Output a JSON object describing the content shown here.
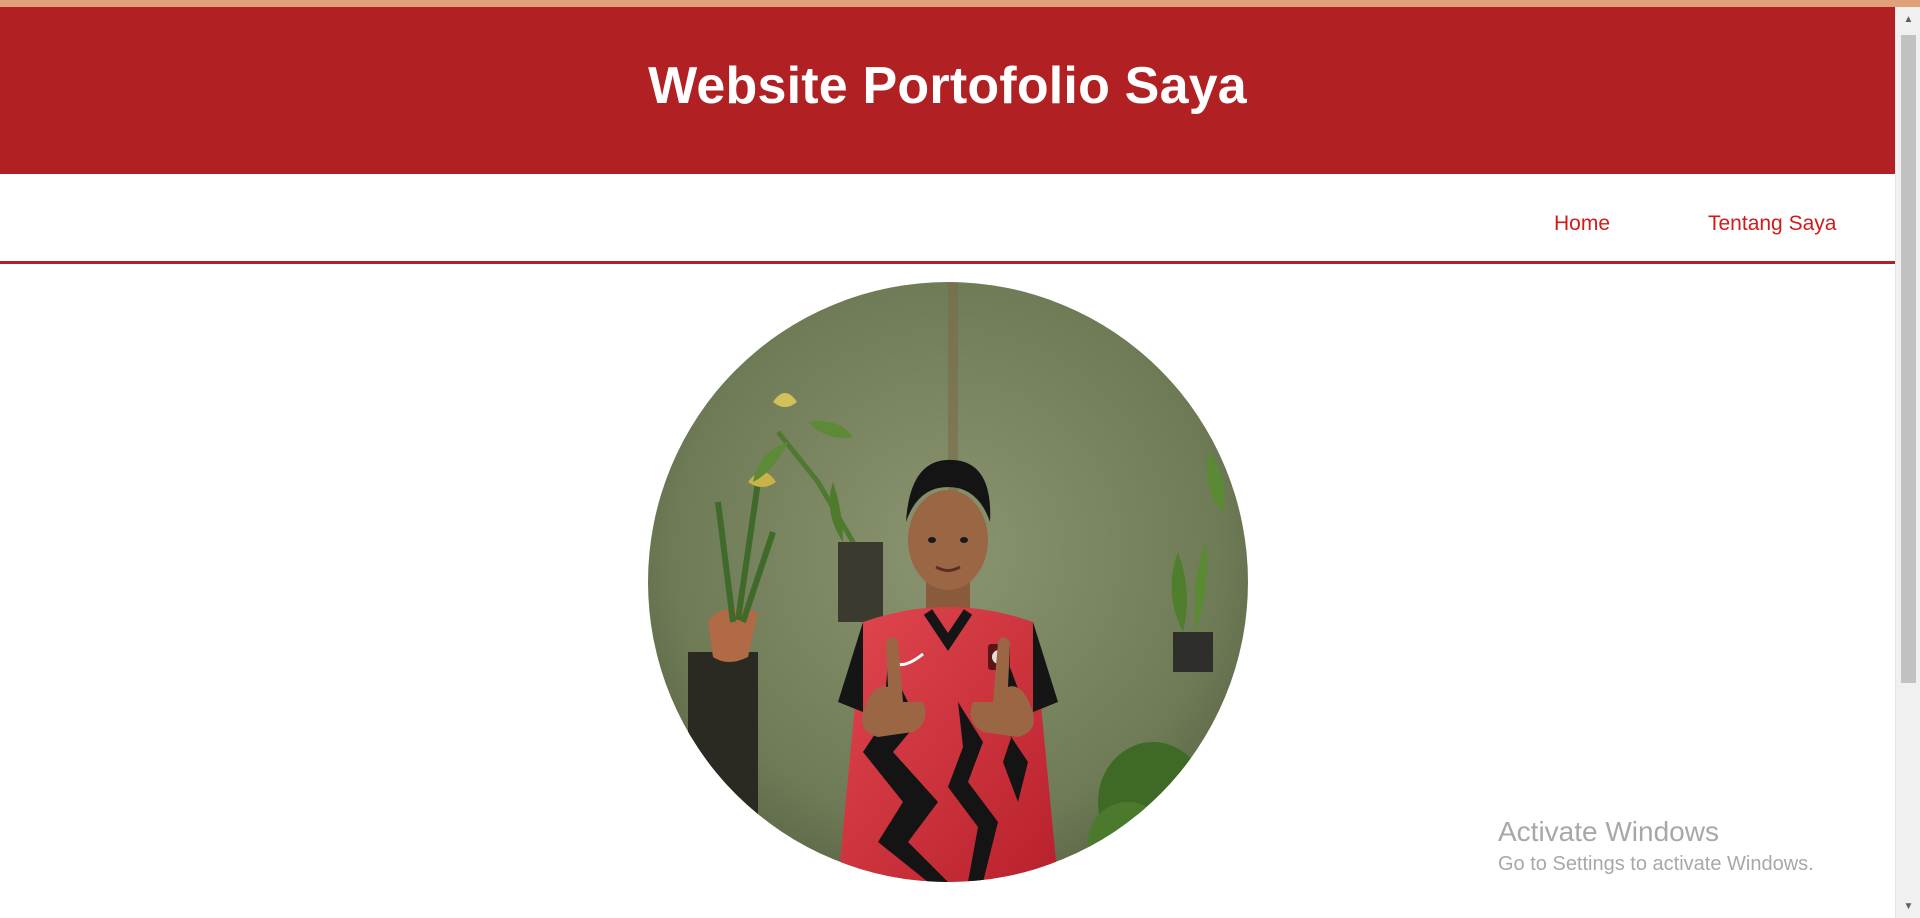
{
  "header": {
    "title": "Website Portofolio Saya"
  },
  "nav": {
    "items": [
      {
        "label": "Home"
      },
      {
        "label": "Tentang Saya"
      }
    ]
  },
  "profile": {
    "image": "profile-photo-boy-red-jersey"
  },
  "watermark": {
    "title": "Activate Windows",
    "subtitle": "Go to Settings to activate Windows."
  },
  "scrollbar": {
    "up_icon": "triangle-up-icon",
    "down_icon": "triangle-down-icon"
  },
  "colors": {
    "header_bg": "#b12023",
    "nav_link": "#d11a1a",
    "nav_border": "#b12023",
    "top_accent": "#e0a07a"
  }
}
